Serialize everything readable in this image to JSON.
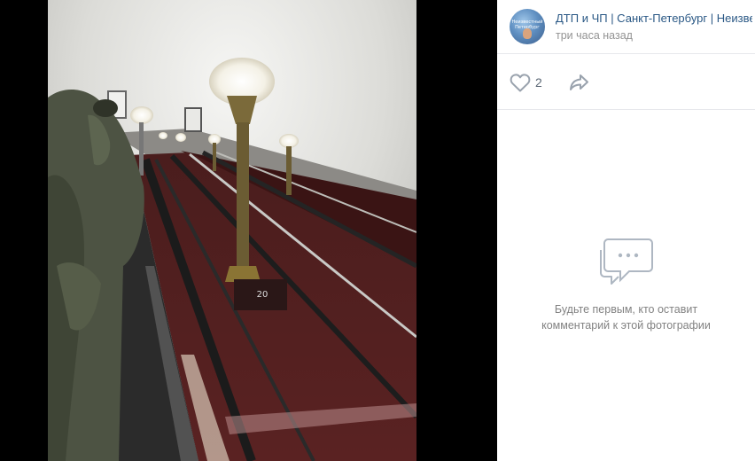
{
  "photo": {
    "description_icon": "escalator-photo",
    "step_marker": "20"
  },
  "post": {
    "author": "ДТП и ЧП | Санкт-Петербург | Неизвестный Петербург",
    "time": "три часа назад",
    "avatar_icon": "community-avatar"
  },
  "actions": {
    "like_icon": "heart-outline-icon",
    "like_count": "2",
    "share_icon": "share-arrow-icon"
  },
  "comments": {
    "empty_icon": "comments-bubble-icon",
    "empty_line1": "Будьте первым, кто оставит",
    "empty_line2": "комментарий к этой фотографии"
  },
  "colors": {
    "link": "#2a5885",
    "muted": "#939393",
    "icon": "#99a2ad"
  }
}
